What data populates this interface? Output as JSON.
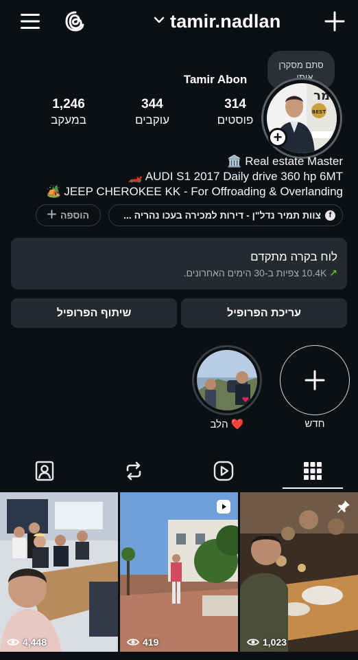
{
  "header": {
    "username": "tamir.nadlan"
  },
  "note": {
    "text": "סתם מסקרן אותי..."
  },
  "profile": {
    "full_name": "Tamir Abon",
    "stats": [
      {
        "value": "314",
        "label": "פוסטים"
      },
      {
        "value": "344",
        "label": "עוקבים"
      },
      {
        "value": "1,246",
        "label": "במעקב"
      }
    ],
    "bio_lines": [
      "🏛️ Real estate Master",
      "🏎️ AUDI S1 2017 Daily drive 360 hp 6MT",
      "🏕️ JEEP CHEROKEE KK - For Offroading & Overlanding"
    ]
  },
  "chips": {
    "link_label": "צוות תמיר נדל\"ן - דירות למכירה בעכו נהריה ...",
    "link_icon": "f",
    "add_label": "הוספה"
  },
  "dashboard": {
    "title": "לוח בקרה מתקדם",
    "subtitle_arrow": "↗",
    "subtitle": "10.4K צפיות ב-30 הימים האחרונים."
  },
  "buttons": {
    "edit_profile": "עריכת הפרופיל",
    "share_profile": "שיתוף הפרופיל"
  },
  "highlights": [
    {
      "label": "חדש"
    },
    {
      "label": "❤️ הלב"
    }
  ],
  "posts": [
    {
      "views": "4,448"
    },
    {
      "views": "419",
      "badge": "reel-icon"
    },
    {
      "views": "1,023",
      "badge": "pin-icon"
    }
  ],
  "colors": {
    "background": "#0c1014",
    "card": "#262a30",
    "accent_green": "#58c322"
  }
}
